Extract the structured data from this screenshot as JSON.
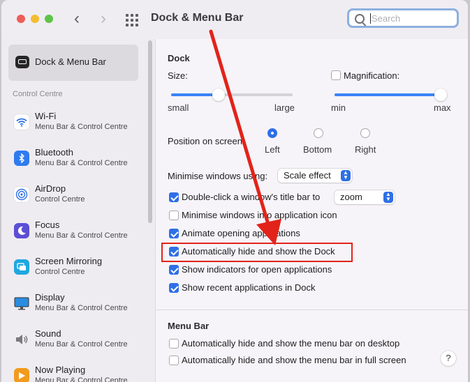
{
  "window": {
    "title": "Dock & Menu Bar"
  },
  "search": {
    "placeholder": "Search"
  },
  "sidebar": {
    "selected": {
      "label": "Dock & Menu Bar"
    },
    "section_label": "Control Centre",
    "items": [
      {
        "name": "Wi-Fi",
        "sub": "Menu Bar & Control Centre",
        "icon": "wifi-icon"
      },
      {
        "name": "Bluetooth",
        "sub": "Menu Bar & Control Centre",
        "icon": "bluetooth-icon"
      },
      {
        "name": "AirDrop",
        "sub": "Control Centre",
        "icon": "airdrop-icon"
      },
      {
        "name": "Focus",
        "sub": "Menu Bar & Control Centre",
        "icon": "focus-moon-icon"
      },
      {
        "name": "Screen Mirroring",
        "sub": "Control Centre",
        "icon": "screen-mirroring-icon"
      },
      {
        "name": "Display",
        "sub": "Menu Bar & Control Centre",
        "icon": "display-icon"
      },
      {
        "name": "Sound",
        "sub": "Menu Bar & Control Centre",
        "icon": "sound-icon"
      },
      {
        "name": "Now Playing",
        "sub": "Menu Bar & Control Centre",
        "icon": "now-playing-icon"
      }
    ]
  },
  "dock": {
    "heading": "Dock",
    "size": {
      "label": "Size:",
      "min_label": "small",
      "max_label": "large",
      "value": 0.39
    },
    "magnification": {
      "label": "Magnification:",
      "checked": false,
      "min_label": "min",
      "max_label": "max",
      "value": 1.0
    },
    "position": {
      "label": "Position on screen:",
      "options": [
        "Left",
        "Bottom",
        "Right"
      ],
      "selected": "Left"
    },
    "minimise": {
      "label": "Minimise windows using:",
      "value": "Scale effect"
    },
    "double_click": {
      "label": "Double-click a window's title bar to",
      "checked": true,
      "value": "zoom"
    },
    "checkboxes": [
      {
        "label": "Minimise windows into application icon",
        "checked": false
      },
      {
        "label": "Animate opening applications",
        "checked": true
      },
      {
        "label": "Automatically hide and show the Dock",
        "checked": true,
        "highlighted": true
      },
      {
        "label": "Show indicators for open applications",
        "checked": true
      },
      {
        "label": "Show recent applications in Dock",
        "checked": true
      }
    ]
  },
  "menu_bar": {
    "heading": "Menu Bar",
    "checkboxes": [
      {
        "label": "Automatically hide and show the menu bar on desktop",
        "checked": false
      },
      {
        "label": "Automatically hide and show the menu bar in full screen",
        "checked": false
      }
    ]
  },
  "help": {
    "label": "?"
  },
  "annotation": {
    "arrow_color": "#e2231a",
    "box_color": "#e2231a"
  },
  "colors": {
    "accent": "#2f6fe6",
    "slider_fill": "#3b82f6"
  }
}
